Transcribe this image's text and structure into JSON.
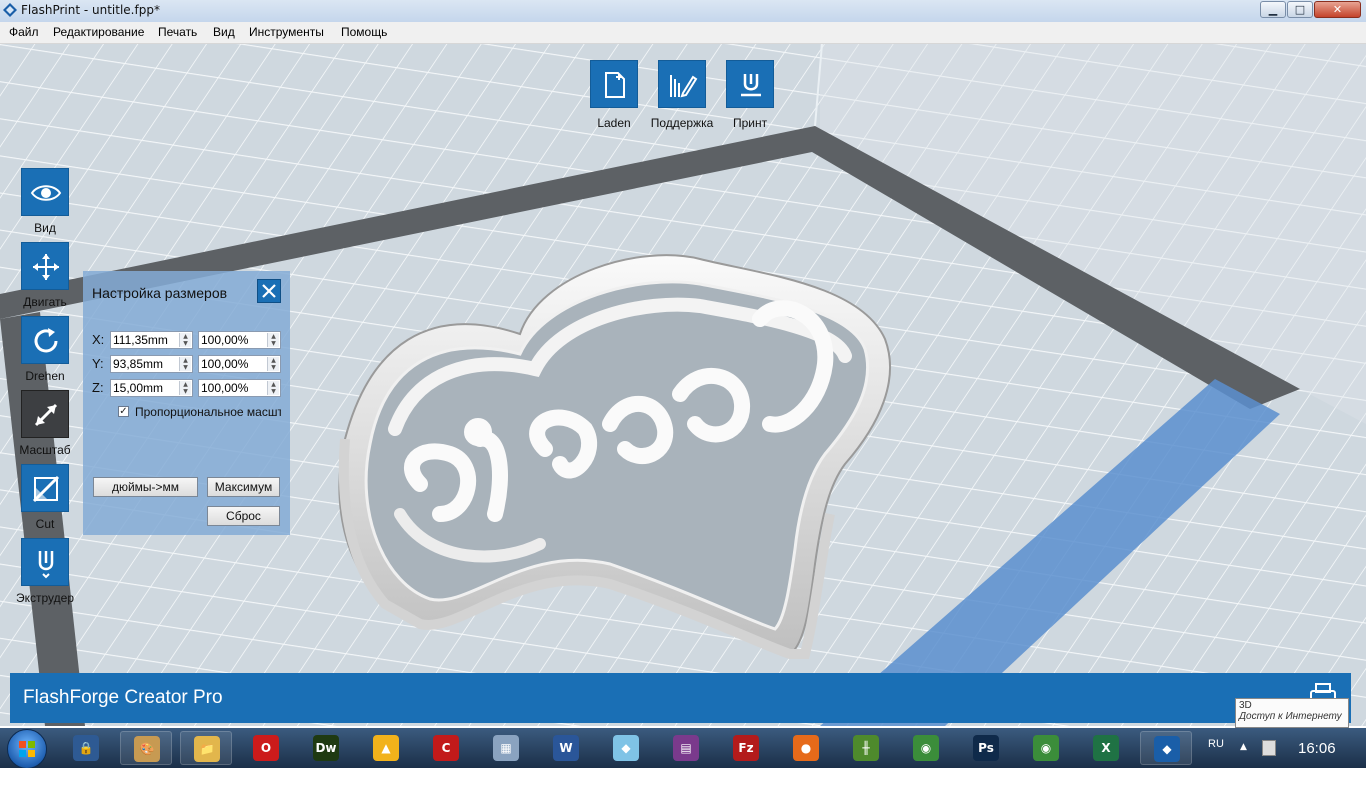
{
  "window": {
    "title": "FlashPrint - untitle.fpp*",
    "min_label": "▁",
    "max_label": "□",
    "close_label": "✕"
  },
  "menu": [
    "Файл",
    "Редактирование",
    "Печать",
    "Вид",
    "Инструменты",
    "Помощь"
  ],
  "top_toolbar": {
    "load_label": "Laden",
    "support_label": "Поддержка",
    "print_label": "Принт"
  },
  "left_toolbar": {
    "view_label": "Вид",
    "move_label": "Двигать",
    "rotate_label": "Drehen",
    "scale_label": "Масштаб",
    "cut_label": "Cut",
    "extruder_label": "Экструдер"
  },
  "scale_panel": {
    "title": "Настройка размеров",
    "x_label": "X:",
    "y_label": "Y:",
    "z_label": "Z:",
    "x_value": "111,35mm",
    "y_value": "93,85mm",
    "z_value": "15,00mm",
    "x_percent": "100,00%",
    "y_percent": "100,00%",
    "z_percent": "100,00%",
    "proportional_checked": true,
    "proportional_label": "Пропорциональное масштабирование",
    "inch_button": "дюймы->мм",
    "max_button": "Максимум",
    "reset_button": "Сброс"
  },
  "status": {
    "printer_name": "FlashForge Creator Pro"
  },
  "tooltip": {
    "line1": "3D",
    "line2": "Доступ к Интернету"
  },
  "taskbar": {
    "language": "RU",
    "time": "16:06",
    "apps": [
      {
        "name": "keepass",
        "glyph": "🔒",
        "color": "#2e5a93"
      },
      {
        "name": "paint",
        "glyph": "🎨",
        "color": "#c79a52"
      },
      {
        "name": "explorer",
        "glyph": "📁",
        "color": "#e2b64c"
      },
      {
        "name": "opera",
        "glyph": "O",
        "color": "#cc1b1b"
      },
      {
        "name": "dreamweaver",
        "glyph": "Dw",
        "color": "#1f3a12"
      },
      {
        "name": "archicad",
        "glyph": "▲",
        "color": "#f2b21b"
      },
      {
        "name": "cad-app",
        "glyph": "C",
        "color": "#c21a1a"
      },
      {
        "name": "calculator",
        "glyph": "▦",
        "color": "#8aa3c0"
      },
      {
        "name": "word",
        "glyph": "W",
        "color": "#2a5699"
      },
      {
        "name": "notes",
        "glyph": "◆",
        "color": "#7fc3e6"
      },
      {
        "name": "winrar",
        "glyph": "▤",
        "color": "#7a3a8c"
      },
      {
        "name": "filezilla",
        "glyph": "Fz",
        "color": "#b31b1b"
      },
      {
        "name": "firefox",
        "glyph": "●",
        "color": "#e66a1a"
      },
      {
        "name": "spreadsheet",
        "glyph": "╫",
        "color": "#4e8a2c"
      },
      {
        "name": "chrome",
        "glyph": "◉",
        "color": "#3b8d3a"
      },
      {
        "name": "photoshop",
        "glyph": "Ps",
        "color": "#0f2a4a"
      },
      {
        "name": "chrome-2",
        "glyph": "◉",
        "color": "#3b8d3a"
      },
      {
        "name": "excel",
        "glyph": "X",
        "color": "#1f7244"
      },
      {
        "name": "flashprint",
        "glyph": "◆",
        "color": "#1a5ea8"
      }
    ]
  },
  "colors": {
    "accent": "#1a6fb5",
    "bed": "#c8d2d9",
    "active_tool": "#3d3f42"
  }
}
